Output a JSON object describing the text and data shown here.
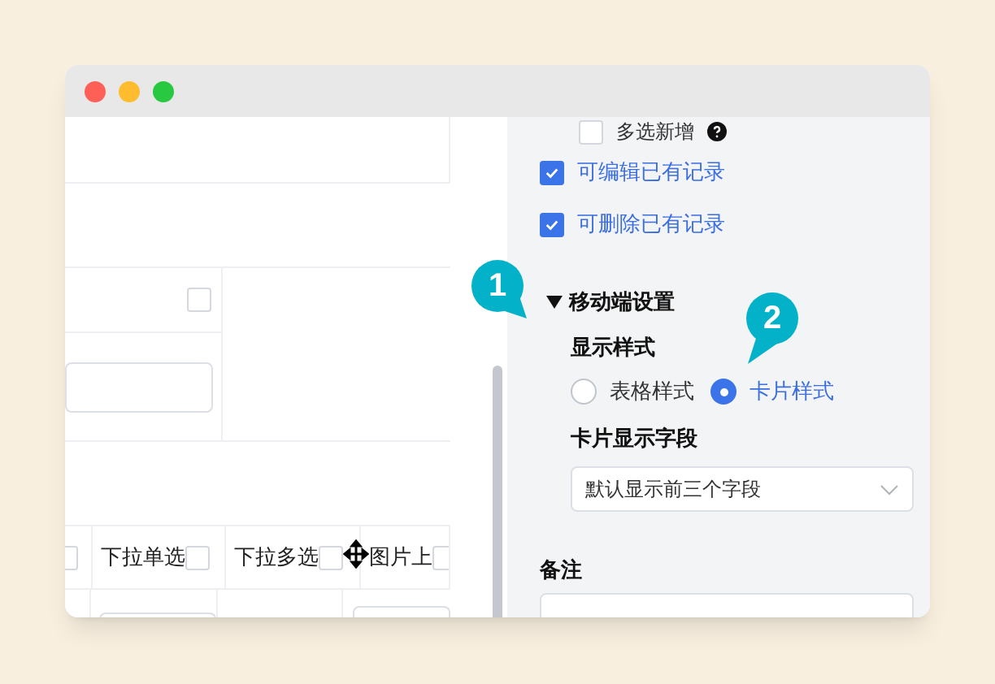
{
  "canvas": {
    "top_checkbox": {
      "checked": false
    },
    "first_column": {
      "checked": false
    },
    "columns": [
      {
        "label": "下拉单选",
        "checked": false
      },
      {
        "label": "下拉多选",
        "checked": false
      },
      {
        "label": "图片上",
        "checked": false
      }
    ]
  },
  "settings": {
    "permissions": [
      {
        "label": "多选新增",
        "checked": false,
        "help": true
      },
      {
        "label": "可编辑已有记录",
        "checked": true,
        "help": false
      },
      {
        "label": "可删除已有记录",
        "checked": true,
        "help": false
      }
    ],
    "mobile": {
      "title": "移动端设置",
      "expanded": true,
      "display_style": {
        "label": "显示样式",
        "options": [
          {
            "label": "表格样式",
            "selected": false
          },
          {
            "label": "卡片样式",
            "selected": true
          }
        ]
      },
      "card_fields": {
        "label": "卡片显示字段",
        "value": "默认显示前三个字段"
      }
    },
    "notes": {
      "label": "备注"
    }
  },
  "callouts": [
    {
      "number": "1"
    },
    {
      "number": "2"
    }
  ]
}
